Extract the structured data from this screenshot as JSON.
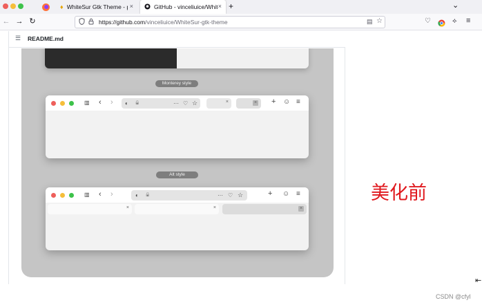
{
  "browser": {
    "tabs": [
      {
        "title": "WhiteSur Gtk Theme - pli",
        "close": "×"
      },
      {
        "title": "GitHub - vinceliuice/Whit",
        "close": "×"
      }
    ],
    "new_tab": "+",
    "tab_list": "⌄",
    "back": "←",
    "forward": "→",
    "reload": "↻",
    "url_host": "https://github.com",
    "url_path": "/vinceliuice/WhiteSur-gtk-theme",
    "reader_icon": "▤",
    "bookmark_icon": "☆",
    "toolbar": {
      "pocket": "♡",
      "extension": "⟡",
      "menu": "≡"
    }
  },
  "readme": {
    "list_icon": "☰",
    "filename": "README.md"
  },
  "preview": {
    "monterey_label": "Monterey style",
    "alt_label": "Alt style",
    "window_icons": {
      "sidebar": "▥",
      "back": "‹",
      "forward": "›",
      "shield": "◐",
      "lock": "🔒",
      "more": "···",
      "pocket": "♡",
      "star": "☆",
      "plus": "+",
      "account": "☺",
      "menu": "≡",
      "close": "×"
    },
    "colors": {
      "red": "#ee5f5b",
      "yellow": "#f5be3a",
      "green": "#3dc24a"
    }
  },
  "annotation": "美化前",
  "watermark": "CSDN @cfyl",
  "cursor": "⇤"
}
